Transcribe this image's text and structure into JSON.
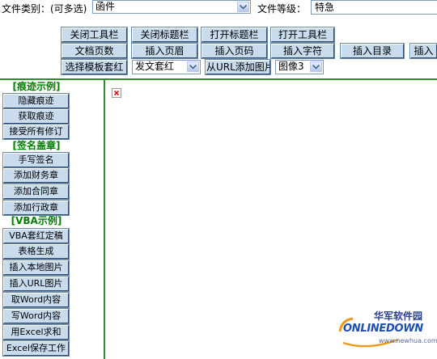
{
  "form": {
    "category_label": "文件类别：(可多选)",
    "category_value": "函件",
    "level_label": "文件等级：",
    "level_value": "特急"
  },
  "toolbar": {
    "close_toolbar": "关闭工具栏",
    "close_titlebar": "关闭标题栏",
    "open_titlebar": "打开标题栏",
    "open_toolbar": "打开工具栏",
    "doc_pages": "文档页数",
    "insert_header": "插入页眉",
    "insert_page_num": "插入页码",
    "insert_chars": "插入字符",
    "insert_toc": "插入目录",
    "insert_partial": "插入",
    "select_template": "选择模板套红",
    "template_select_value": "发文套红",
    "add_image_from_url": "从URL添加图片",
    "image_select_value": "图像3"
  },
  "sidebar": {
    "sections": [
      {
        "title": "[痕迹示例]",
        "items": [
          "隐藏痕迹",
          "获取痕迹",
          "接受所有修订"
        ]
      },
      {
        "title": "[签名盖章]",
        "items": [
          "手写签名",
          "添加财务章",
          "添加合同章",
          "添加行政章"
        ]
      },
      {
        "title": "[VBA示例]",
        "items": [
          "VBA套红定稿",
          "表格生成",
          "插入本地图片",
          "插入URL图片",
          "取Word内容",
          "写Word内容",
          "用Excel求和",
          "Excel保存工作"
        ]
      }
    ]
  },
  "watermark": {
    "chinese": "华军软件园",
    "brand": "ONLINEDOWN",
    "url": "www.newhua.com"
  },
  "colors": {
    "accent_green": "#008000",
    "button_face": "#c8dced",
    "border_blue": "#7f9db9"
  }
}
